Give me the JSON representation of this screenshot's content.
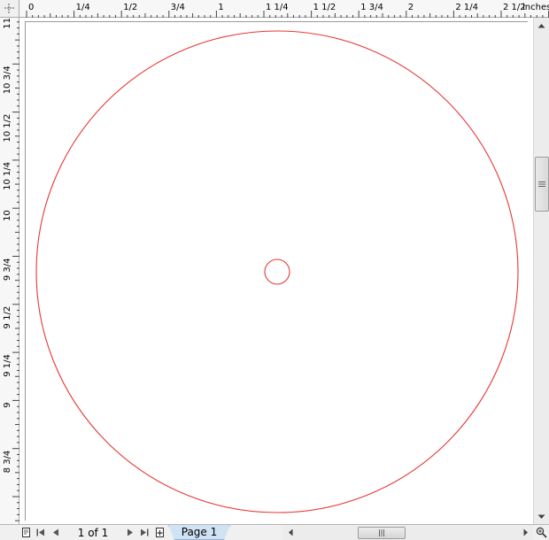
{
  "window": {
    "title": ""
  },
  "rulers": {
    "units_label": "inches",
    "horizontal": [
      {
        "label": "0"
      },
      {
        "label": "1/4"
      },
      {
        "label": "1/2"
      },
      {
        "label": "3/4"
      },
      {
        "label": "1"
      },
      {
        "label": "1 1/4"
      },
      {
        "label": "1 1/2"
      },
      {
        "label": "1 3/4"
      },
      {
        "label": "2"
      },
      {
        "label": "2 1/4"
      },
      {
        "label": "2 1/2"
      }
    ],
    "vertical": [
      {
        "label": "11"
      },
      {
        "label": "10 3/4"
      },
      {
        "label": "10 1/2"
      },
      {
        "label": "10 1/4"
      },
      {
        "label": "10"
      },
      {
        "label": "9 3/4"
      },
      {
        "label": "9 1/2"
      },
      {
        "label": "9 1/4"
      },
      {
        "label": "9"
      },
      {
        "label": "8 3/4"
      }
    ]
  },
  "canvas": {
    "shapes": [
      {
        "type": "circle",
        "name": "outer-circle",
        "stroke": "#e53935"
      },
      {
        "type": "circle",
        "name": "inner-circle",
        "stroke": "#e53935"
      }
    ]
  },
  "pagination": {
    "page_count_text": "1 of 1",
    "page_tab_label": "Page 1"
  },
  "icons": {
    "first_page": "first-page-icon",
    "prev_page": "prev-page-icon",
    "next_page": "next-page-icon",
    "last_page": "last-page-icon",
    "add_page": "add-page-icon",
    "zoom": "zoom-icon"
  }
}
